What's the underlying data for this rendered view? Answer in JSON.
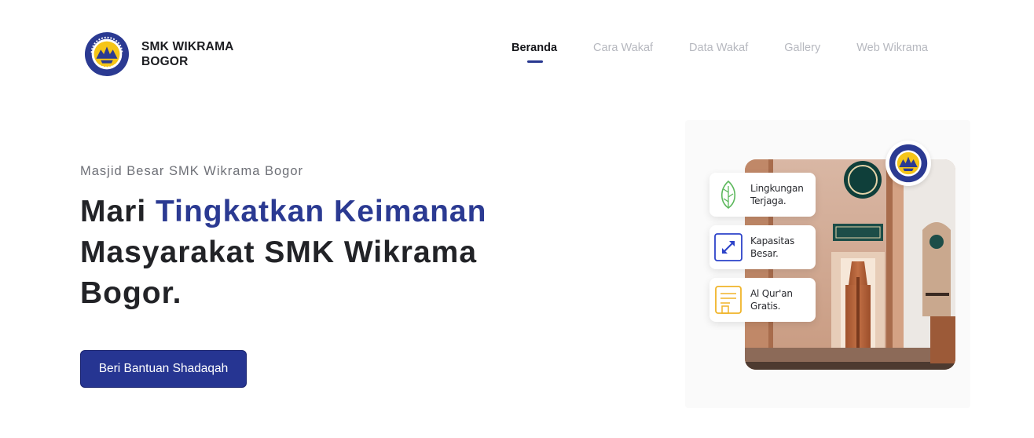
{
  "header": {
    "brand_line1": "SMK WIKRAMA",
    "brand_line2": "BOGOR",
    "logo_icon": "school-emblem-icon",
    "nav": [
      {
        "label": "Beranda",
        "active": true
      },
      {
        "label": "Cara Wakaf",
        "active": false
      },
      {
        "label": "Data Wakaf",
        "active": false
      },
      {
        "label": "Gallery",
        "active": false
      },
      {
        "label": "Web Wikrama",
        "active": false
      }
    ]
  },
  "hero": {
    "subtitle": "Masjid Besar SMK Wikrama Bogor",
    "headline_part1": "Mari ",
    "headline_accent": "Tingkatkan Keimanan",
    "headline_part2": " Masyarakat SMK Wikrama Bogor.",
    "cta_label": "Beri Bantuan Shadaqah"
  },
  "illustration": {
    "features": [
      {
        "text": "Lingkungan\nTerjaga.",
        "icon": "leaf-icon",
        "color": "#5cb85c"
      },
      {
        "text": "Kapasitas\nBesar.",
        "icon": "expand-arrows-icon",
        "color": "#2d43c9"
      },
      {
        "text": "Al Qur'an\nGratis.",
        "icon": "document-icon",
        "color": "#f0b429"
      }
    ]
  },
  "colors": {
    "accent": "#263592",
    "nav_inactive": "#b6b8bf"
  }
}
